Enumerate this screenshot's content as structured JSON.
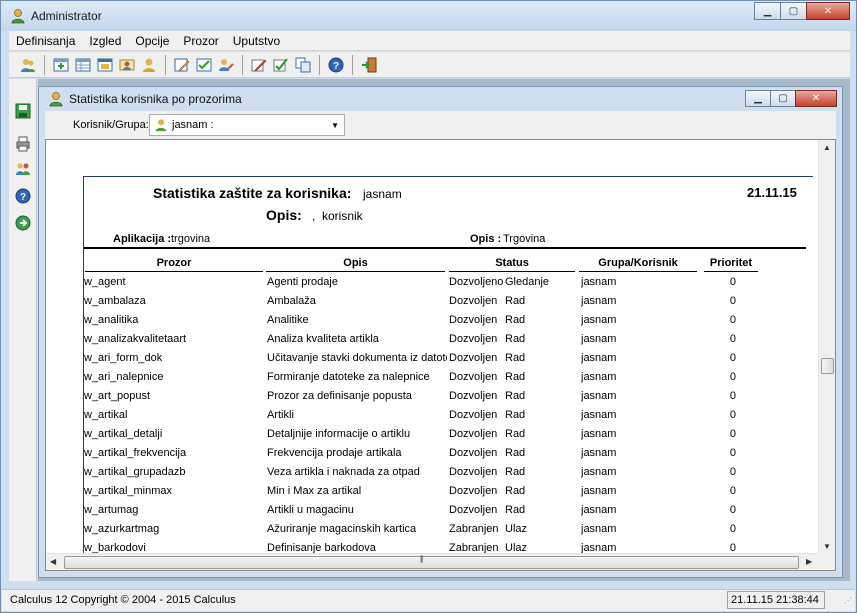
{
  "window": {
    "title": "Administrator"
  },
  "menu": [
    "Definisanja",
    "Izgled",
    "Opcije",
    "Prozor",
    "Uputstvo"
  ],
  "toolbar": {
    "icons": [
      "users-icon",
      "add-table-icon",
      "table-icon",
      "window-icon",
      "group-icon",
      "user-icon",
      "edit-form-icon",
      "checklist-icon",
      "user-edit-icon",
      "pencil-icon",
      "approve-icon",
      "copy-icon",
      "help-icon",
      "exit-icon"
    ]
  },
  "child_window": {
    "title": "Statistika korisnika po prozorima",
    "filter": {
      "label": "Korisnik/Grupa:",
      "value": "jasnam :"
    }
  },
  "report": {
    "title": "Statistika zaštite za korisnika:",
    "user": "jasnam",
    "date": "21.11.15",
    "opis_label": "Opis:",
    "opis_value": ",  korisnik",
    "aplikacija_label": "Aplikacija :",
    "aplikacija_value": "trgovina",
    "app_opis_label": "Opis :",
    "app_opis_value": "Trgovina",
    "columns": [
      "Prozor",
      "Opis",
      "Status",
      "Grupa/Korisnik",
      "Prioritet"
    ],
    "rows": [
      {
        "prozor": "w_agent",
        "opis": "Agenti prodaje",
        "status": "Dozvoljeno",
        "pristup": "Gledanje",
        "grupa": "jasnam",
        "prioritet": "0"
      },
      {
        "prozor": "w_ambalaza",
        "opis": "Ambalaža",
        "status": "Dozvoljen",
        "pristup": "Rad",
        "grupa": "jasnam",
        "prioritet": "0"
      },
      {
        "prozor": "w_analitika",
        "opis": "Analitike",
        "status": "Dozvoljen",
        "pristup": "Rad",
        "grupa": "jasnam",
        "prioritet": "0"
      },
      {
        "prozor": "w_analizakvalitetaart",
        "opis": "Analiza kvaliteta artikla",
        "status": "Dozvoljen",
        "pristup": "Rad",
        "grupa": "jasnam",
        "prioritet": "0"
      },
      {
        "prozor": "w_ari_form_dok",
        "opis": "Učitavanje stavki dokumenta iz datote",
        "status": "Dozvoljen",
        "pristup": "Rad",
        "grupa": "jasnam",
        "prioritet": "0"
      },
      {
        "prozor": "w_ari_nalepnice",
        "opis": "Formiranje datoteke za nalepnice",
        "status": "Dozvoljen",
        "pristup": "Rad",
        "grupa": "jasnam",
        "prioritet": "0"
      },
      {
        "prozor": "w_art_popust",
        "opis": "Prozor za definisanje popusta",
        "status": "Dozvoljen",
        "pristup": "Rad",
        "grupa": "jasnam",
        "prioritet": "0"
      },
      {
        "prozor": "w_artikal",
        "opis": "Artikli",
        "status": "Dozvoljen",
        "pristup": "Rad",
        "grupa": "jasnam",
        "prioritet": "0"
      },
      {
        "prozor": "w_artikal_detalji",
        "opis": "Detaljnije informacije o artiklu",
        "status": "Dozvoljen",
        "pristup": "Rad",
        "grupa": "jasnam",
        "prioritet": "0"
      },
      {
        "prozor": "w_artikal_frekvencija",
        "opis": "Frekvencija prodaje artikala",
        "status": "Dozvoljen",
        "pristup": "Rad",
        "grupa": "jasnam",
        "prioritet": "0"
      },
      {
        "prozor": "w_artikal_grupadazb",
        "opis": "Veza artikla i naknada za otpad",
        "status": "Dozvoljen",
        "pristup": "Rad",
        "grupa": "jasnam",
        "prioritet": "0"
      },
      {
        "prozor": "w_artikal_minmax",
        "opis": "Min i Max za artikal",
        "status": "Dozvoljen",
        "pristup": "Rad",
        "grupa": "jasnam",
        "prioritet": "0"
      },
      {
        "prozor": "w_artumag",
        "opis": "Artikli u magacinu",
        "status": "Dozvoljen",
        "pristup": "Rad",
        "grupa": "jasnam",
        "prioritet": "0"
      },
      {
        "prozor": "w_azurkartmag",
        "opis": "Ažuriranje magacinskih kartica",
        "status": "Zabranjen",
        "pristup": "Ulaz",
        "grupa": "jasnam",
        "prioritet": "0"
      },
      {
        "prozor": "w_barkodovi",
        "opis": "Definisanje barkodova",
        "status": "Zabranjen",
        "pristup": "Ulaz",
        "grupa": "jasnam",
        "prioritet": "0"
      }
    ]
  },
  "statusbar": {
    "left": "Calculus 12  Copyright © 2004 - 2015  Calculus",
    "right": "21.11.15 21:38:44"
  },
  "colors": {
    "titlebar": "#c3d6ee",
    "report_border": "#1a3a8a",
    "close_button": "#c6402b"
  }
}
